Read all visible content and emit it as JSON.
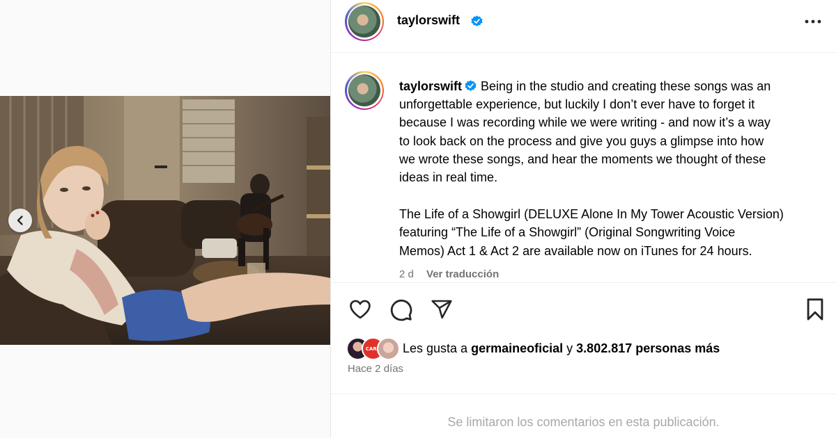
{
  "post": {
    "username": "taylorswift",
    "verified": true,
    "caption_lines": [
      "Being in the studio and creating these songs was an",
      "unforgettable experience, but luckily I don’t ever have to forget it",
      "because I was recording while we were writing - and now it’s a way",
      "to look back on the process and give you guys a glimpse into how",
      "we wrote these songs, and hear the moments we thought of these",
      "ideas in real time."
    ],
    "caption_lines_2": [
      "The Life of a Showgirl (DELUXE Alone In My Tower Acoustic Version)",
      "featuring “The Life of a Showgirl” (Original Songwriting Voice",
      "Memos) Act 1 & Act 2 are available now on iTunes for 24 hours."
    ],
    "age_short": "2 d",
    "translate_label": "Ver traducción",
    "likes_prefix": "Les gusta a",
    "likes_user": "germaineoficial",
    "likes_conjunction": "y",
    "likes_count_text": "3.802.817 personas más",
    "posted_ago": "Hace 2 días",
    "comments_disabled": "Se limitaron los comentarios en esta publicación.",
    "liker_badge_text": "CARA"
  },
  "icons": {
    "verified": "verified-badge-icon",
    "more": "more-options-icon",
    "like": "heart-icon",
    "comment": "comment-icon",
    "share": "send-icon",
    "save": "bookmark-icon",
    "prev": "chevron-left-icon"
  },
  "colors": {
    "verified_blue": "#0095f6",
    "muted_text": "#737373",
    "disabled_text": "#a8a8a8",
    "liker_badge_red": "#e0322b"
  }
}
